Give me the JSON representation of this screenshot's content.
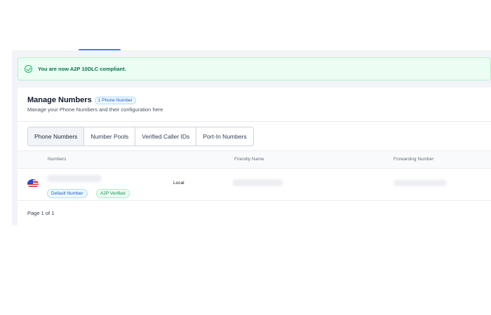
{
  "alert": {
    "icon": "check-circle-icon",
    "message": "You are now A2P 10DLC compliant."
  },
  "manage": {
    "title": "Manage Numbers",
    "count_badge": "1 Phone Number",
    "subtitle": "Manage your Phone Numbers and their configuration here"
  },
  "tabs": [
    {
      "label": "Phone Numbers",
      "active": true
    },
    {
      "label": "Number Pools",
      "active": false
    },
    {
      "label": "Verified Caller IDs",
      "active": false
    },
    {
      "label": "Port-In Numbers",
      "active": false
    }
  ],
  "table": {
    "columns": [
      "Numbers",
      "Friendly Name",
      "Forwarding Number"
    ],
    "rows": [
      {
        "flag": "us-flag-icon",
        "badges": [
          "Default Number",
          "A2P Verified"
        ],
        "type": "Local"
      }
    ]
  },
  "pagination": {
    "label": "Page 1 of 1"
  },
  "colors": {
    "accent": "#3b82f6",
    "success": "#12b76a",
    "success_bg": "#ecfdf3",
    "info": "#175cd3"
  }
}
